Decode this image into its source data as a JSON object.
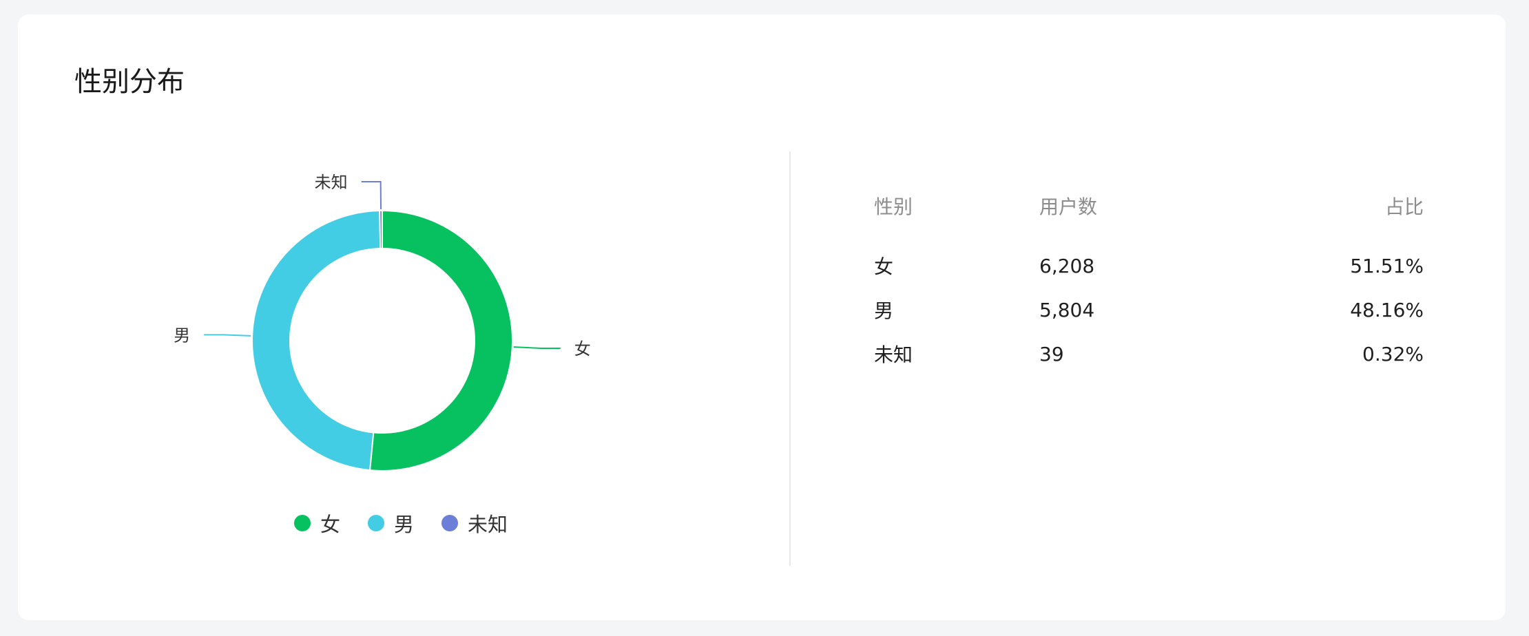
{
  "card": {
    "title": "性别分布"
  },
  "colors": {
    "female": "#07c160",
    "male": "#43cde4",
    "unknown": "#6b7ed8"
  },
  "chart_data": {
    "type": "pie",
    "title": "",
    "categories": [
      "女",
      "男",
      "未知"
    ],
    "values": [
      6208,
      5804,
      39
    ],
    "colors": [
      "#07c160",
      "#43cde4",
      "#6b7ed8"
    ],
    "donut": true,
    "legend": "bottom",
    "labels": [
      "女",
      "男",
      "未知"
    ]
  },
  "legend": [
    {
      "label": "女",
      "color": "#07c160"
    },
    {
      "label": "男",
      "color": "#43cde4"
    },
    {
      "label": "未知",
      "color": "#6b7ed8"
    }
  ],
  "table": {
    "headers": {
      "gender": "性别",
      "users": "用户数",
      "ratio": "占比"
    },
    "rows": [
      {
        "gender": "女",
        "users": "6,208",
        "ratio": "51.51%"
      },
      {
        "gender": "男",
        "users": "5,804",
        "ratio": "48.16%"
      },
      {
        "gender": "未知",
        "users": "39",
        "ratio": "0.32%"
      }
    ]
  }
}
